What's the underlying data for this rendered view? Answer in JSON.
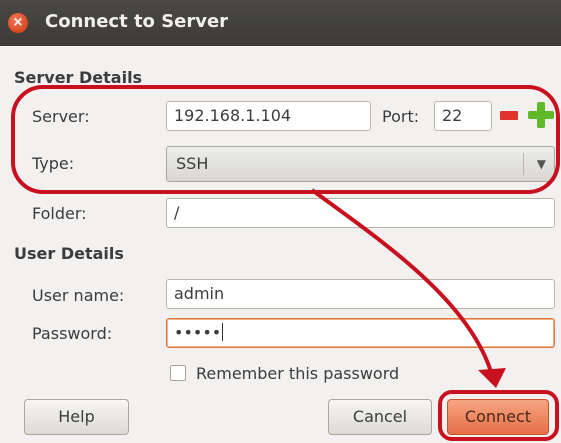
{
  "window": {
    "title": "Connect to Server",
    "close_glyph": "×"
  },
  "server_section": {
    "heading": "Server Details",
    "server_label": "Server:",
    "server_value": "192.168.1.104",
    "port_label": "Port:",
    "port_value": "22",
    "type_label": "Type:",
    "type_value": "SSH",
    "folder_label": "Folder:",
    "folder_value": "/"
  },
  "user_section": {
    "heading": "User Details",
    "username_label": "User name:",
    "username_value": "admin",
    "password_label": "Password:",
    "password_value": "•••••",
    "remember_label": "Remember this password",
    "remember_checked": false
  },
  "buttons": {
    "help": "Help",
    "cancel": "Cancel",
    "connect": "Connect"
  },
  "icons": {
    "spin_down": "minus-icon",
    "spin_up": "plus-icon",
    "dropdown": "chevron-down-icon"
  },
  "colors": {
    "annotation": "#c8101e",
    "titlebar": "#3c3b37",
    "connect_button": "#e56f45"
  }
}
